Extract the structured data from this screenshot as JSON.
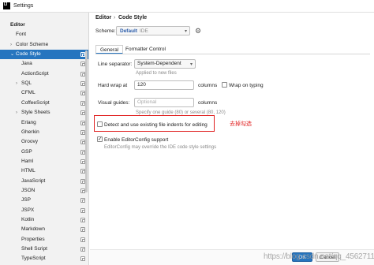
{
  "window": {
    "title": "Settings",
    "app_icon_glyph": "IJ"
  },
  "sidebar": {
    "items": [
      {
        "label": "Editor",
        "bold": true,
        "indent": 0,
        "arrow": "",
        "selected": false,
        "copy": false
      },
      {
        "label": "Font",
        "bold": false,
        "indent": 1,
        "arrow": "",
        "selected": false,
        "copy": false
      },
      {
        "label": "Color Scheme",
        "bold": false,
        "indent": 1,
        "arrow": "›",
        "selected": false,
        "copy": false
      },
      {
        "label": "Code Style",
        "bold": false,
        "indent": 1,
        "arrow": "⌄",
        "selected": true,
        "copy": true
      },
      {
        "label": "Java",
        "bold": false,
        "indent": 2,
        "arrow": "",
        "selected": false,
        "copy": true
      },
      {
        "label": "ActionScript",
        "bold": false,
        "indent": 2,
        "arrow": "",
        "selected": false,
        "copy": true
      },
      {
        "label": "SQL",
        "bold": false,
        "indent": 2,
        "arrow": "›",
        "selected": false,
        "copy": true
      },
      {
        "label": "CFML",
        "bold": false,
        "indent": 2,
        "arrow": "",
        "selected": false,
        "copy": true
      },
      {
        "label": "CoffeeScript",
        "bold": false,
        "indent": 2,
        "arrow": "",
        "selected": false,
        "copy": true
      },
      {
        "label": "Style Sheets",
        "bold": false,
        "indent": 2,
        "arrow": "›",
        "selected": false,
        "copy": true
      },
      {
        "label": "Erlang",
        "bold": false,
        "indent": 2,
        "arrow": "",
        "selected": false,
        "copy": true
      },
      {
        "label": "Gherkin",
        "bold": false,
        "indent": 2,
        "arrow": "",
        "selected": false,
        "copy": true
      },
      {
        "label": "Groovy",
        "bold": false,
        "indent": 2,
        "arrow": "",
        "selected": false,
        "copy": true
      },
      {
        "label": "GSP",
        "bold": false,
        "indent": 2,
        "arrow": "",
        "selected": false,
        "copy": true
      },
      {
        "label": "Haml",
        "bold": false,
        "indent": 2,
        "arrow": "",
        "selected": false,
        "copy": true
      },
      {
        "label": "HTML",
        "bold": false,
        "indent": 2,
        "arrow": "",
        "selected": false,
        "copy": true
      },
      {
        "label": "JavaScript",
        "bold": false,
        "indent": 2,
        "arrow": "",
        "selected": false,
        "copy": true
      },
      {
        "label": "JSON",
        "bold": false,
        "indent": 2,
        "arrow": "",
        "selected": false,
        "copy": true
      },
      {
        "label": "JSP",
        "bold": false,
        "indent": 2,
        "arrow": "",
        "selected": false,
        "copy": true
      },
      {
        "label": "JSPX",
        "bold": false,
        "indent": 2,
        "arrow": "",
        "selected": false,
        "copy": true
      },
      {
        "label": "Kotlin",
        "bold": false,
        "indent": 2,
        "arrow": "",
        "selected": false,
        "copy": true
      },
      {
        "label": "Markdown",
        "bold": false,
        "indent": 2,
        "arrow": "",
        "selected": false,
        "copy": true
      },
      {
        "label": "Properties",
        "bold": false,
        "indent": 2,
        "arrow": "",
        "selected": false,
        "copy": true
      },
      {
        "label": "Shell Script",
        "bold": false,
        "indent": 2,
        "arrow": "",
        "selected": false,
        "copy": true
      },
      {
        "label": "TypeScript",
        "bold": false,
        "indent": 2,
        "arrow": "",
        "selected": false,
        "copy": true
      }
    ]
  },
  "breadcrumb": {
    "part1": "Editor",
    "separator": "›",
    "part2": "Code Style"
  },
  "scheme": {
    "label": "Scheme:",
    "name": "Default",
    "scope": "IDE",
    "arrow": "▾",
    "gear_glyph": "⚙"
  },
  "tabs": [
    {
      "label": "General"
    },
    {
      "label": "Formatter Control"
    }
  ],
  "general": {
    "line_separator_label": "Line separator:",
    "line_separator_value": "System-Dependent",
    "line_separator_arrow": "▾",
    "line_separator_hint": "Applied to new files",
    "hard_wrap_label": "Hard wrap at",
    "hard_wrap_value": "120",
    "hard_wrap_unit": "columns",
    "wrap_on_typing_label": "Wrap on typing",
    "wrap_on_typing_checked": false,
    "visual_guides_label": "Visual guides:",
    "visual_guides_placeholder": "Optional",
    "visual_guides_unit": "columns",
    "visual_guides_hint": "Specify one guide (80) or several (80, 120)",
    "detect_indents_label": "Detect and use existing file indents for editing",
    "detect_indents_checked": false,
    "editorconfig_label": "Enable EditorConfig support",
    "editorconfig_checked": true,
    "editorconfig_hint": "EditorConfig may override the IDE code style settings"
  },
  "annotation": {
    "note": "去掉勾选",
    "color": "#e02020"
  },
  "buttons": {
    "ok": "OK",
    "cancel": "Cancel"
  },
  "watermark": "https://blog.csdn.net/qq_45627111",
  "colors": {
    "selection": "#2675bf",
    "scheme_name": "#2a5caa"
  }
}
